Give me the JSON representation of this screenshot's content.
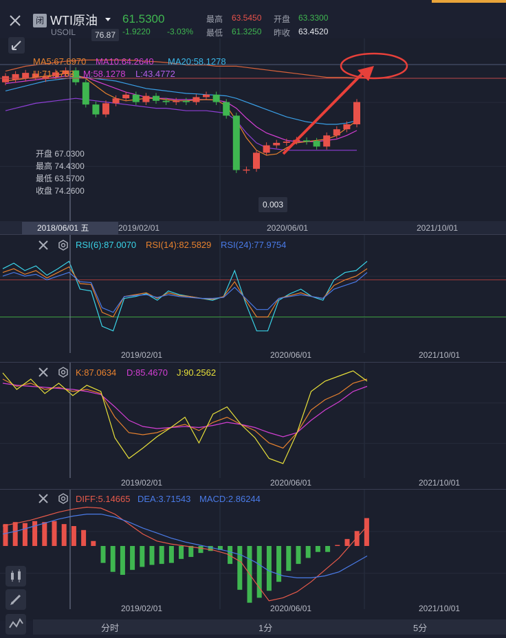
{
  "header": {
    "symbol": "WTI原油",
    "code": "USOIL",
    "closed_badge": "闭",
    "price": "61.5300",
    "change": "-1.9220",
    "change_pct": "-3.03%",
    "high_label": "最高",
    "high_value": "63.5450",
    "open_label": "开盘",
    "open_value": "63.3300",
    "low_label": "最低",
    "low_value": "61.3250",
    "prev_label": "昨收",
    "prev_value": "63.4520"
  },
  "main": {
    "ma5": "MA5:67.8970",
    "ma10": "MA10:64.2640",
    "ma20": "MA20:58.1278",
    "boll_u": "U:71.1783",
    "boll_m": "M:58.1278",
    "boll_l": "L:43.4772",
    "max_marker": "76.87",
    "min_marker": "0.003",
    "ohlc": [
      {
        "label": "开盘",
        "value": "67.0300"
      },
      {
        "label": "最高",
        "value": "74.4300"
      },
      {
        "label": "最低",
        "value": "63.5700"
      },
      {
        "label": "收盘",
        "value": "74.2600"
      }
    ],
    "cursor_date": "2018/06/01 五"
  },
  "rsi": {
    "r6": "RSI(6):87.0070",
    "r14": "RSI(14):82.5829",
    "r24": "RSI(24):77.9754"
  },
  "kdj": {
    "k": "K:87.0634",
    "d": "D:85.4670",
    "j": "J:90.2562"
  },
  "macd": {
    "diff": "DIFF:5.14665",
    "dea": "DEA:3.71543",
    "macd": "MACD:2.86244"
  },
  "axis_dates": [
    "2019/02/01",
    "2020/06/01",
    "2021/10/01"
  ],
  "tabs": [
    "分时",
    "1分",
    "5分"
  ],
  "colors": {
    "up": "#e8524a",
    "down": "#3fb650",
    "ma5": "#e8822e",
    "ma10": "#d33fd3",
    "ma20": "#3aa0e8",
    "boll_upper": "#d8623a"
  },
  "chart_data": [
    {
      "type": "candlestick",
      "panel": "main",
      "x_tick_labels": [
        "2019/02/01",
        "2020/06/01",
        "2021/10/01"
      ],
      "candles": [
        {
          "o": 69.5,
          "c": 72.0
        },
        {
          "o": 70.5,
          "c": 72.8
        },
        {
          "o": 71.0,
          "c": 73.3
        },
        {
          "o": 71.5,
          "c": 73.0
        },
        {
          "o": 70.8,
          "c": 71.8
        },
        {
          "o": 72.0,
          "c": 73.5
        },
        {
          "o": 72.8,
          "c": 74.3
        },
        {
          "o": 74.3,
          "c": 69.5
        },
        {
          "o": 69.5,
          "c": 60.5
        },
        {
          "o": 60.5,
          "c": 56.5
        },
        {
          "o": 56.5,
          "c": 61.0
        },
        {
          "o": 61.0,
          "c": 63.0
        },
        {
          "o": 63.0,
          "c": 64.5
        },
        {
          "o": 64.5,
          "c": 61.5
        },
        {
          "o": 61.5,
          "c": 64.0
        },
        {
          "o": 64.0,
          "c": 62.0
        },
        {
          "o": 62.0,
          "c": 61.5
        },
        {
          "o": 61.5,
          "c": 62.0
        },
        {
          "o": 62.0,
          "c": 61.5
        },
        {
          "o": 61.5,
          "c": 63.5
        },
        {
          "o": 63.5,
          "c": 64.5
        },
        {
          "o": 64.5,
          "c": 61.5
        },
        {
          "o": 61.5,
          "c": 56.0
        },
        {
          "o": 56.0,
          "c": 34.0
        },
        {
          "o": 33.8,
          "c": 34.2
        },
        {
          "o": 34.5,
          "c": 41.0
        },
        {
          "o": 41.0,
          "c": 44.0
        },
        {
          "o": 44.0,
          "c": 45.0
        },
        {
          "o": 45.0,
          "c": 45.5
        },
        {
          "o": 45.5,
          "c": 46.2
        },
        {
          "o": 46.0,
          "c": 45.5
        },
        {
          "o": 45.8,
          "c": 43.5
        },
        {
          "o": 43.5,
          "c": 48.0
        },
        {
          "o": 48.0,
          "c": 50.5
        },
        {
          "o": 50.5,
          "c": 52.5
        },
        {
          "o": 52.5,
          "c": 61.5
        }
      ],
      "ma5": [
        70,
        70.5,
        71,
        71.5,
        72,
        72.5,
        73,
        72.5,
        71,
        68,
        65,
        63,
        62,
        62.5,
        63,
        63,
        62.5,
        62,
        62,
        62.3,
        62.5,
        62.3,
        60,
        54,
        47,
        42,
        40,
        40.5,
        43,
        45,
        45.5,
        46,
        46.5,
        48,
        51,
        54
      ],
      "ma10": [
        69,
        69.5,
        70,
        70.5,
        71,
        71.5,
        72,
        72,
        71.5,
        70,
        68.5,
        67,
        65.5,
        64.5,
        63.5,
        63,
        63,
        62.5,
        62.5,
        62.5,
        62.5,
        62.3,
        61.5,
        59,
        55,
        51.5,
        49,
        47.5,
        46,
        45.5,
        45.5,
        45.5,
        46,
        46.5,
        48,
        50
      ],
      "ma20": [
        66,
        67,
        68,
        69,
        70,
        70.5,
        71,
        71.5,
        71.5,
        71,
        70.5,
        70,
        69,
        68,
        67,
        66.5,
        66,
        65.5,
        65,
        64.8,
        64.5,
        64.3,
        64,
        63,
        61.5,
        60,
        58.5,
        57,
        55.5,
        54.5,
        53.5,
        53,
        52.5,
        52.5,
        53,
        54
      ],
      "boll_upper": [
        74,
        75,
        76,
        76.5,
        77,
        77.5,
        78,
        78.3,
        78.5,
        78.5,
        78.5,
        78.5,
        78.5,
        78.3,
        78,
        77.8,
        77.5,
        77,
        76.5,
        76.5,
        76.5,
        76,
        76,
        76,
        75.5,
        75,
        74.5,
        74,
        73.5,
        73,
        72.5,
        72,
        71.5,
        71.5,
        71.5,
        71.2
      ],
      "boll_lower": [
        58,
        59,
        60,
        61,
        61.5,
        62,
        62.5,
        63,
        62.5,
        62,
        61.5,
        61,
        60.5,
        60,
        59.5,
        59,
        59,
        58.5,
        58,
        58,
        58,
        57.5,
        57,
        54,
        49,
        45,
        43,
        42.5,
        42,
        42,
        42,
        42,
        42,
        42,
        42,
        42
      ]
    },
    {
      "type": "line",
      "panel": "rsi",
      "series": [
        {
          "name": "RSI(6)",
          "values": [
            82,
            88,
            80,
            85,
            75,
            82,
            90,
            60,
            58,
            20,
            15,
            50,
            52,
            55,
            48,
            58,
            54,
            52,
            50,
            48,
            52,
            80,
            45,
            15,
            15,
            48,
            55,
            60,
            52,
            48,
            70,
            78,
            80,
            90
          ]
        },
        {
          "name": "RSI(14)",
          "values": [
            78,
            82,
            76,
            80,
            72,
            78,
            84,
            66,
            65,
            35,
            30,
            52,
            54,
            56,
            50,
            56,
            53,
            52,
            50,
            49,
            52,
            68,
            48,
            30,
            30,
            50,
            53,
            56,
            52,
            50,
            64,
            70,
            74,
            82
          ]
        },
        {
          "name": "RSI(24)",
          "values": [
            74,
            78,
            74,
            76,
            70,
            74,
            78,
            68,
            67,
            40,
            35,
            52,
            53,
            54,
            51,
            54,
            52,
            51,
            50,
            50,
            51,
            62,
            50,
            38,
            38,
            50,
            52,
            54,
            52,
            50,
            60,
            64,
            68,
            78
          ]
        }
      ]
    },
    {
      "type": "line",
      "panel": "kdj",
      "series": [
        {
          "name": "K",
          "values": [
            92,
            85,
            88,
            82,
            84,
            80,
            82,
            78,
            55,
            40,
            38,
            40,
            45,
            48,
            42,
            50,
            55,
            48,
            42,
            30,
            25,
            40,
            62,
            72,
            78,
            88,
            92
          ]
        },
        {
          "name": "D",
          "values": [
            88,
            86,
            85,
            84,
            83,
            82,
            80,
            77,
            65,
            52,
            46,
            44,
            45,
            46,
            45,
            47,
            50,
            48,
            45,
            40,
            36,
            40,
            52,
            62,
            70,
            80,
            85
          ]
        },
        {
          "name": "J",
          "values": [
            98,
            82,
            92,
            78,
            88,
            76,
            86,
            80,
            35,
            15,
            25,
            36,
            45,
            55,
            30,
            58,
            65,
            48,
            35,
            15,
            10,
            40,
            80,
            90,
            95,
            100,
            90
          ]
        }
      ]
    },
    {
      "type": "bar+line",
      "panel": "macd",
      "macd_bars": [
        2.2,
        2.4,
        2.3,
        2.5,
        2.4,
        2.5,
        2.2,
        2.0,
        1.6,
        0.5,
        -1.7,
        -2.6,
        -2.9,
        -2.4,
        -2.1,
        -1.9,
        -1.8,
        -1.7,
        -1.3,
        -1.1,
        -0.7,
        -0.5,
        -0.4,
        -1.8,
        -4.4,
        -5.7,
        -5.2,
        -4.5,
        -3.6,
        -2.5,
        -1.8,
        -1.2,
        -0.6,
        -0.6,
        0.1,
        0.7,
        1.5,
        2.8
      ],
      "series": [
        {
          "name": "DIFF",
          "values": [
            2.0,
            2.3,
            2.6,
            3.0,
            3.4,
            3.7,
            3.9,
            3.8,
            3.2,
            2.2,
            1.2,
            0.5,
            0.2,
            0.0,
            -0.2,
            -0.4,
            -0.8,
            -1.6,
            -3.6,
            -5.5,
            -5.2,
            -4.6,
            -3.6,
            -2.4,
            -1.2,
            0.4,
            2.0
          ]
        },
        {
          "name": "DEA",
          "values": [
            1.2,
            1.5,
            1.9,
            2.3,
            2.7,
            3.0,
            3.2,
            3.2,
            2.9,
            2.4,
            1.8,
            1.3,
            0.8,
            0.4,
            0.1,
            -0.2,
            -0.5,
            -0.9,
            -1.6,
            -2.5,
            -3.0,
            -3.2,
            -3.2,
            -3.0,
            -2.6,
            -1.8,
            -1.0
          ]
        }
      ]
    }
  ]
}
